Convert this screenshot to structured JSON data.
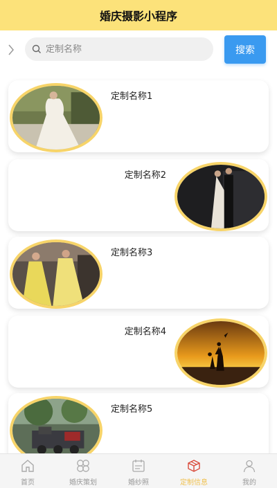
{
  "header": {
    "title": "婚庆摄影小程序"
  },
  "search": {
    "placeholder": "定制名称",
    "button_label": "搜索"
  },
  "cards": [
    {
      "name": "定制名称1",
      "align": "left",
      "photo": "bride-gown"
    },
    {
      "name": "定制名称2",
      "align": "right",
      "photo": "couple-dark"
    },
    {
      "name": "定制名称3",
      "align": "left",
      "photo": "yellow-dresses"
    },
    {
      "name": "定制名称4",
      "align": "right",
      "photo": "sunset-silhouette"
    },
    {
      "name": "定制名称5",
      "align": "left",
      "photo": "garden-train"
    }
  ],
  "tabbar": {
    "items": [
      {
        "label": "首页",
        "icon": "home-icon"
      },
      {
        "label": "婚庆策划",
        "icon": "clover-icon"
      },
      {
        "label": "婚纱照",
        "icon": "calendar-icon"
      },
      {
        "label": "定制信息",
        "icon": "box-icon",
        "active": true
      },
      {
        "label": "我的",
        "icon": "user-icon"
      }
    ]
  },
  "colors": {
    "header_bg": "#fce27a",
    "accent_blue": "#3a9af0",
    "frame_gold": "#f7d469",
    "active_tab": "#f0c150"
  }
}
